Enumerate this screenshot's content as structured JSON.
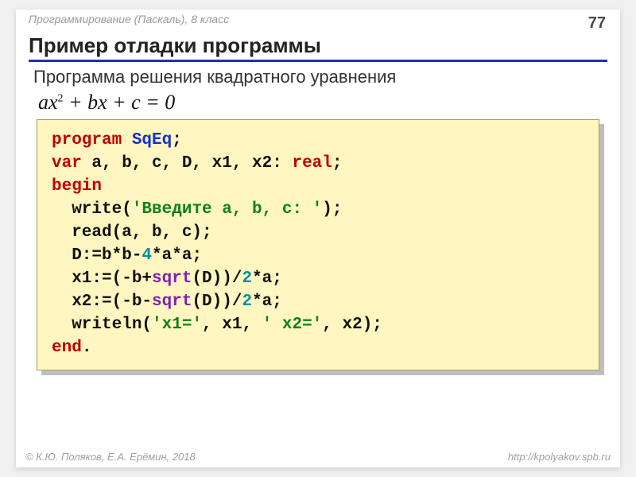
{
  "header": {
    "course": "Программирование (Паскаль), 8 класс",
    "page": "77"
  },
  "title": "Пример отладки программы",
  "subtitle": "Программа решения квадратного уравнения",
  "equation": {
    "a": "ax",
    "sup": "2",
    "rest": " + bx + c = 0"
  },
  "code": {
    "l1_kw": "program ",
    "l1_id": "SqEq",
    "l1_end": ";",
    "l2_kw": "var",
    "l2_vars": " a, b, c, D, x1, x2: ",
    "l2_type": "real",
    "l2_end": ";",
    "l3": "begin",
    "l4_a": "  write(",
    "l4_str": "'Введите a, b, c: '",
    "l4_b": ");",
    "l5": "  read(a, b, c);",
    "l6_a": "  D:=b*b-",
    "l6_num": "4",
    "l6_b": "*a*a;",
    "l7_a": "  x1:=(-b+",
    "l7_fn": "sqrt",
    "l7_b": "(D))/",
    "l7_num": "2",
    "l7_c": "*a;",
    "l8_a": "  x2:=(-b-",
    "l8_fn": "sqrt",
    "l8_b": "(D))/",
    "l8_num": "2",
    "l8_c": "*a;",
    "l9_a": "  writeln(",
    "l9_s1": "'x1='",
    "l9_b": ", x1, ",
    "l9_s2": "' x2='",
    "l9_c": ", x2);",
    "l10_a": "end",
    "l10_b": "."
  },
  "footer": {
    "authors": "© К.Ю. Поляков, Е.А. Ерёмин, 2018",
    "url": "http://kpolyakov.spb.ru"
  }
}
